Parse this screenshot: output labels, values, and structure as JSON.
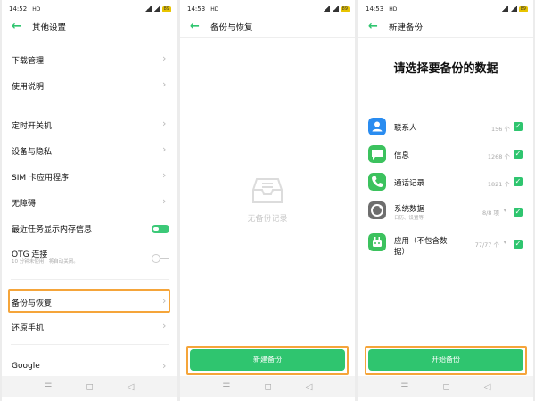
{
  "colors": {
    "accent": "#2fc56f",
    "highlight": "#f5a53a",
    "chevron": "#b8b8b8"
  },
  "screen1": {
    "status": {
      "time": "14:52",
      "network": "HD",
      "battery": "89"
    },
    "title": "其他设置",
    "items": [
      {
        "label": "下载管理",
        "type": "nav"
      },
      {
        "label": "使用说明",
        "type": "nav"
      },
      {
        "label": "定时开关机",
        "type": "nav"
      },
      {
        "label": "设备与隐私",
        "type": "nav"
      },
      {
        "label": "SIM 卡应用程序",
        "type": "nav"
      },
      {
        "label": "无障碍",
        "type": "nav"
      },
      {
        "label": "最近任务显示内存信息",
        "type": "toggle",
        "on": true
      },
      {
        "label": "OTG 连接",
        "sub": "10 分钟未使用，将自动关闭。",
        "type": "toggle",
        "on": false
      },
      {
        "label": "备份与恢复",
        "type": "nav",
        "highlighted": true
      },
      {
        "label": "还原手机",
        "type": "nav"
      },
      {
        "label": "Google",
        "type": "nav"
      }
    ]
  },
  "screen2": {
    "status": {
      "time": "14:53",
      "network": "HD",
      "battery": "89"
    },
    "title": "备份与恢复",
    "empty_text": "无备份记录",
    "button_label": "新建备份"
  },
  "screen3": {
    "status": {
      "time": "14:53",
      "network": "HD",
      "battery": "89"
    },
    "title": "新建备份",
    "heading": "请选择要备份的数据",
    "rows": [
      {
        "label": "联系人",
        "count": "156 个",
        "icon": "contacts-icon",
        "color": "#2a8cf0",
        "checked": true
      },
      {
        "label": "信息",
        "count": "1268 个",
        "icon": "messages-icon",
        "color": "#3cc25e",
        "checked": true
      },
      {
        "label": "通话记录",
        "count": "1821 个",
        "icon": "phone-icon",
        "color": "#3cc25e",
        "checked": true
      },
      {
        "label": "系统数据",
        "sub": "日历、设置等",
        "count": "8/8 项",
        "icon": "system-data-icon",
        "color": "#6e6e6e",
        "checked": true,
        "expandable": true
      },
      {
        "label": "应用（不包含数",
        "label2": "据）",
        "count": "77/77 个",
        "icon": "apps-icon",
        "color": "#3cc25e",
        "checked": true,
        "expandable": true
      }
    ],
    "button_label": "开始备份"
  },
  "navbar": {
    "menu": "☰",
    "home": "◻",
    "back": "◁"
  }
}
